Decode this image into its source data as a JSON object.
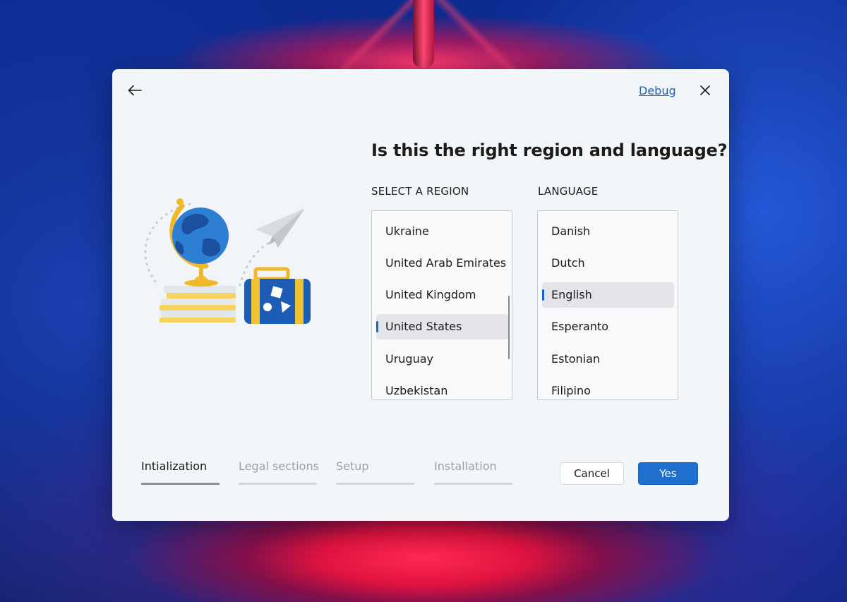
{
  "dialog": {
    "back_icon": "arrow-left-icon",
    "debug_label": "Debug",
    "close_icon": "close-icon",
    "title": "Is this the right region and language?"
  },
  "region": {
    "label": "SELECT A REGION",
    "items": [
      "Ukraine",
      "United Arab Emirates",
      "United Kingdom",
      "United States",
      "Uruguay",
      "Uzbekistan"
    ],
    "selected": "United States"
  },
  "language": {
    "label": "LANGUAGE",
    "items": [
      "Danish",
      "Dutch",
      "English",
      "Esperanto",
      "Estonian",
      "Filipino"
    ],
    "selected": "English"
  },
  "steps": [
    {
      "label": "Intialization",
      "active": true
    },
    {
      "label": "Legal sections",
      "active": false
    },
    {
      "label": "Setup",
      "active": false
    },
    {
      "label": "Installation",
      "active": false
    }
  ],
  "buttons": {
    "cancel": "Cancel",
    "yes": "Yes"
  },
  "colors": {
    "accent": "#1f6fce",
    "link": "#1764c6",
    "dialog_bg": "#f3f6f9"
  }
}
